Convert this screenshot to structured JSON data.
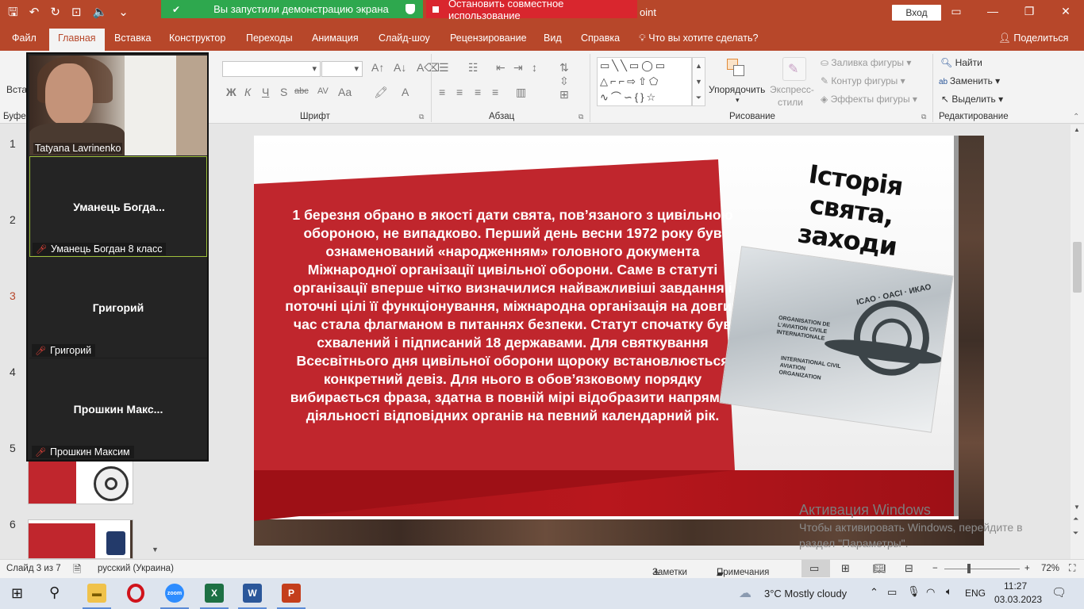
{
  "titlebar": {
    "title_suffix": "oint",
    "signin": "Вход",
    "share_notice": "Вы запустили демонстрацию экрана",
    "stop_share": "Остановить совместное использование",
    "colors": {
      "titlebar": "#b7472a",
      "share_green": "#2ea84e",
      "share_red": "#d9262e"
    }
  },
  "tabs": {
    "items": [
      "Файл",
      "Главная",
      "Вставка",
      "Конструктор",
      "Переходы",
      "Анимация",
      "Слайд-шоу",
      "Рецензирование",
      "Вид",
      "Справка"
    ],
    "active": "Главная",
    "tell_me": "Что вы хотите сделать?",
    "share": "Поделиться"
  },
  "ribbon": {
    "groups": {
      "clipboard_partial": "Буфер",
      "paste_partial": "Вста",
      "font": "Шрифт",
      "paragraph": "Абзац",
      "drawing": "Рисование",
      "editing": "Редактирование"
    },
    "arrange": "Упорядочить",
    "quick_styles_line1": "Экспресс-",
    "quick_styles_line2": "стили",
    "shape_fill": "Заливка фигуры",
    "shape_outline": "Контур фигуры",
    "shape_effects": "Эффекты фигуры",
    "find": "Найти",
    "replace": "Заменить",
    "select": "Выделить",
    "font_buttons": [
      "Ж",
      "К",
      "Ч",
      "S",
      "abc",
      "AV",
      "Aa",
      "A"
    ]
  },
  "thumbnails": {
    "numbers": [
      "1",
      "2",
      "3",
      "4",
      "5",
      "6"
    ],
    "current": "3"
  },
  "video_panel": {
    "participants": [
      {
        "label": "Tatyana Lavrinenko",
        "has_video": true
      },
      {
        "center_name": "Уманець  Богда...",
        "label": "Уманець Богдан 8 класс",
        "muted": true,
        "active": true
      },
      {
        "center_name": "Григорий",
        "label": "Григорий",
        "muted": true
      },
      {
        "center_name": "Прошкин  Макс...",
        "label": "Прошкин Максим",
        "muted": true
      }
    ]
  },
  "slide": {
    "title": "Історія свята, заходи",
    "body": "1 березня обрано в якості дати свята, пов’язаного з цивільною обороною, не випадково. Перший день весни 1972 року був ознаменований «народженням» головного документа Міжнародної організації цивільної оборони. Саме в статуті організації вперше чітко визначилися найважливіші завдання і поточні цілі її функціонування, міжнародна організація на довгий час стала флагманом в питаннях безпеки. Статут спочатку був схвалений і підписаний 18 державами. Для святкування Всесвітнього дня цивільної оборони щороку встановлюється конкретний девіз. Для нього в обов’язковому порядку вибирається фраза, здатна в повній мірі відобразити напрямок діяльності відповідних органів на певний календарний рік.",
    "image_text_1": "ORGANISATION DE L'AVIATION CIVILE INTERNATIONALE",
    "image_text_2": "INTERNATIONAL CIVIL AVIATION ORGANIZATION",
    "image_arc": "ICAO · OACI · ИКАО",
    "colors": {
      "red": "#c0262d",
      "band": "#a8141a"
    }
  },
  "watermark": {
    "line1": "Активация Windows",
    "line2": "Чтобы активировать Windows, перейдите в",
    "line3": "раздел \"Параметры\"."
  },
  "status": {
    "slide": "Слайд 3 из 7",
    "language": "русский (Украина)",
    "notes": "Заметки",
    "comments": "Примечания",
    "zoom": "72%"
  },
  "taskbar": {
    "weather": "3°C  Mostly cloudy",
    "lang": "ENG",
    "time": "11:27",
    "date": "03.03.2023"
  }
}
